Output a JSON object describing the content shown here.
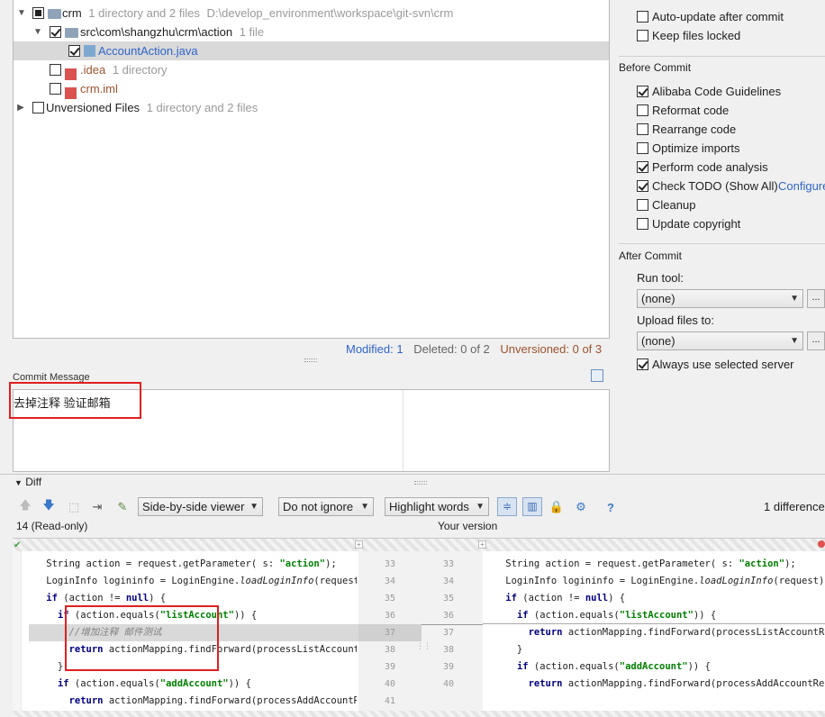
{
  "tree": {
    "root": {
      "name": "crm",
      "info": "1 directory and 2 files",
      "path": "D:\\develop_environment\\workspace\\git-svn\\crm"
    },
    "src": {
      "name": "src\\com\\shangzhu\\crm\\action",
      "info": "1 file"
    },
    "file": {
      "name": "AccountAction.java"
    },
    "idea": {
      "name": ".idea",
      "info": "1 directory"
    },
    "iml": {
      "name": "crm.iml"
    },
    "unversioned": {
      "name": "Unversioned Files",
      "info": "1 directory and 2 files"
    }
  },
  "status": {
    "modified": "Modified: 1",
    "deleted": "Deleted: 0 of 2",
    "unversioned": "Unversioned: 0 of 3"
  },
  "commit": {
    "label": "Commit Message",
    "message": "去掉注释 验证邮箱"
  },
  "options": {
    "auto_update": "Auto-update after commit",
    "keep_locked": "Keep files locked",
    "before_commit": "Before Commit",
    "alibaba": "Alibaba Code Guidelines",
    "reformat": "Reformat code",
    "rearrange": "Rearrange code",
    "optimize": "Optimize imports",
    "analysis": "Perform code analysis",
    "todo": "Check TODO (Show All)",
    "configure": "Configure",
    "cleanup": "Cleanup",
    "copyright": "Update copyright",
    "after_commit": "After Commit",
    "run_tool": "Run tool:",
    "run_tool_value": "(none)",
    "upload": "Upload files to:",
    "upload_value": "(none)",
    "always_server": "Always use selected server",
    "ellipsis": "..."
  },
  "diff": {
    "label": "Diff",
    "viewer": "Side-by-side viewer",
    "ignore": "Do not ignore",
    "highlight": "Highlight words",
    "differences": "1 difference",
    "left_title": "14 (Read-only)",
    "right_title": "Your version",
    "help": "?"
  },
  "left_code": [
    {
      "n": "33",
      "t": "    String action = request.getParameter( s: \"action\");"
    },
    {
      "n": "34",
      "t": "    LoginInfo logininfo = LoginEngine.loadLoginInfo(request)"
    },
    {
      "n": "35",
      "t": "    if (action != null) {"
    },
    {
      "n": "36",
      "t": "      if (action.equals(\"listAccount\")) {"
    },
    {
      "n": "37",
      "t": "        //增加注释 邮件测试"
    },
    {
      "n": "38",
      "t": "        return actionMapping.findForward(processListAccount"
    },
    {
      "n": "39",
      "t": "      }"
    },
    {
      "n": "40",
      "t": "      if (action.equals(\"addAccount\")) {"
    },
    {
      "n": "41",
      "t": "        return actionMapping.findForward(processAddAccountR"
    }
  ],
  "right_code": [
    {
      "n": "33",
      "t": "    String action = request.getParameter( s: \"action\");"
    },
    {
      "n": "34",
      "t": "    LoginInfo logininfo = LoginEngine.loadLoginInfo(request);"
    },
    {
      "n": "35",
      "t": "    if (action != null) {"
    },
    {
      "n": "36",
      "t": "      if (action.equals(\"listAccount\")) {"
    },
    {
      "n": "37",
      "t": "        return actionMapping.findForward(processListAccountReq"
    },
    {
      "n": "38",
      "t": "      }"
    },
    {
      "n": "39",
      "t": "      if (action.equals(\"addAccount\")) {"
    },
    {
      "n": "40",
      "t": "        return actionMapping.findForward(processAddAccountReq"
    }
  ],
  "colors": {
    "accent": "#2f65ca",
    "unversioned": "#a0522d",
    "highlight": "#e02020"
  }
}
